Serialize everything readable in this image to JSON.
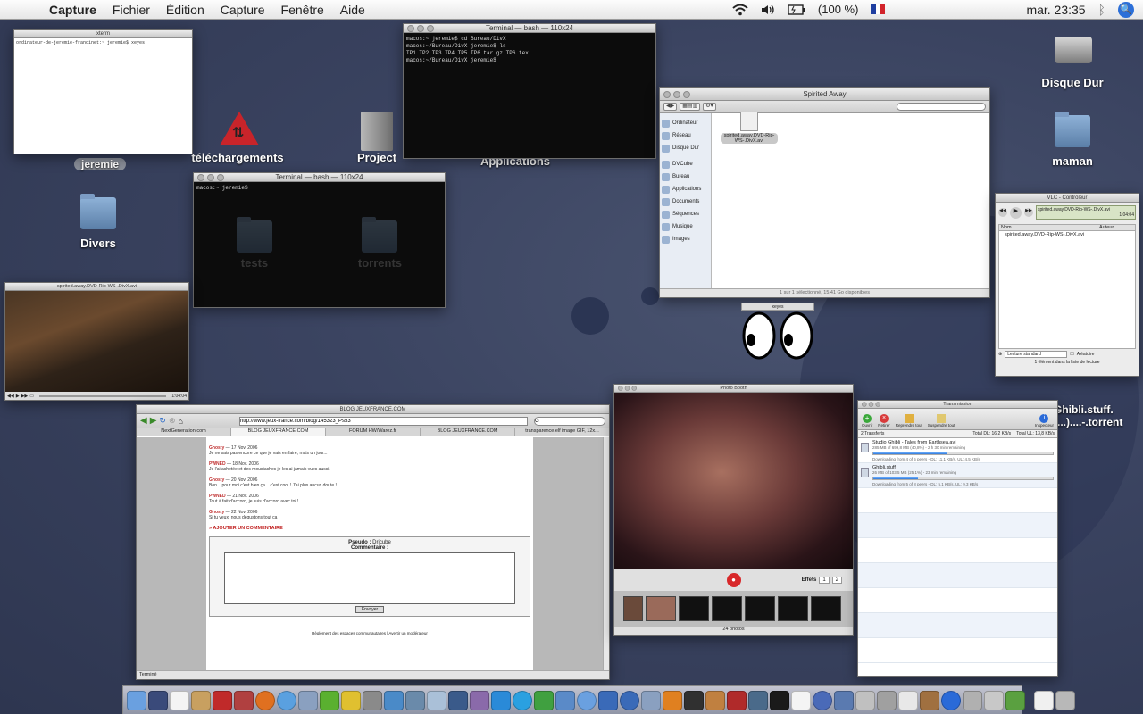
{
  "menubar": {
    "app_name": "Capture",
    "items": [
      "Fichier",
      "Édition",
      "Capture",
      "Fenêtre",
      "Aide"
    ],
    "battery": "(100 %)",
    "clock": "mar. 23:35"
  },
  "desktop": {
    "icons": [
      {
        "label": "jeremie"
      },
      {
        "label": "téléchargements"
      },
      {
        "label": "Project"
      },
      {
        "label": "Applications"
      },
      {
        "label": "Disque Dur"
      },
      {
        "label": "maman"
      },
      {
        "label": "Divers"
      },
      {
        "label": "tests"
      },
      {
        "label": "torrents"
      },
      {
        "label": "Ghibli.stuff.(...)....-.torrent"
      }
    ]
  },
  "xterm": {
    "title": "xterm",
    "line1": "ordinateur-de-jeremie-francinet:~ jeremie$ xeyes"
  },
  "terminal1": {
    "title": "Terminal — bash — 110x24",
    "line1": "macos:~ jeremie$ cd Bureau/DivX",
    "line2": "macos:~/Bureau/DivX jeremie$ ls",
    "line3": "TP1  TP2  TP3  TP4  TP5  TP6.tar.gz  TP6.tex",
    "line4": "macos:~/Bureau/DivX jeremie$"
  },
  "terminal2": {
    "title": "Terminal — bash — 110x24",
    "line1": "macos:~ jeremie$"
  },
  "finder": {
    "title": "Spirited Away",
    "search_placeholder": "",
    "sidebar": [
      "Ordinateur",
      "Réseau",
      "Disque Dur",
      "DVCube",
      "Bureau",
      "Applications",
      "Documents",
      "Séquences",
      "Musique",
      "Images"
    ],
    "file_name": "spirited.away.DVD-Rip-WS-.DivX.avi",
    "status": "1 sur 1 sélectionné, 15,41 Go disponibles"
  },
  "xeyes": {
    "title": "xeyes"
  },
  "vlc_video": {
    "title": "spirited.away.DVD-Rip-WS-.DivX.avi",
    "time": "1:04:04"
  },
  "vlc_controller": {
    "title": "VLC - Contrôleur",
    "now_playing": "spirited.away.DVD-Rip-WS-.DivX.avi",
    "time": "1:04:04",
    "col_name": "Nom",
    "col_author": "Auteur",
    "playlist_item": "spirited.away.DVD-Rip-WS-.DivX.avi",
    "mode": "Lecture standard",
    "random": "Aléatoire",
    "footer": "1 élément dans la liste de lecture"
  },
  "browser": {
    "title": "BLOG JEUXFRANCE.COM",
    "url": "http://www.jeux-france.com/blog/145323_Ps53",
    "search_value": "G",
    "tabs": [
      "NextGeneration.com",
      "BLOG JEUXFRANCE.COM",
      "FORUM HW/Warez.fr",
      "BLOG JEUXFRANCE.COM",
      "transparence.elf image GIF, 12x..."
    ],
    "comments": [
      {
        "author": "Ghosty",
        "date": "17 Nov. 2006",
        "text": "Je ne sais pas encore ce que je vais en faire, mais un jour..."
      },
      {
        "author": "PWNED",
        "date": "18 Nov. 2006",
        "text": "Je l'ai achetée et des moustaches je les ai jamais vues aussi."
      },
      {
        "author": "Ghosty",
        "date": "20 Nov. 2006",
        "text": "Bon... pour moi c'est bien ça... c'est cool ! J'ai plus aucun doute !"
      },
      {
        "author": "PWNED",
        "date": "21 Nov. 2006",
        "text": "Tout à fait d'accord, je suis d'accord avec toi !"
      },
      {
        "author": "Ghosty",
        "date": "22 Nov. 2006",
        "text": "Si tu veux, nous dégustons tout ça !"
      }
    ],
    "add_comment": "» AJOUTER UN COMMENTAIRE",
    "pseudo_label": "Pseudo :",
    "pseudo_value": "Dricube",
    "comment_label": "Commentaire :",
    "submit": "Envoyer",
    "footer": "Règlement des espaces communautaires | Avertir un modérateur",
    "status": "Terminé"
  },
  "photobooth": {
    "title": "Photo Booth",
    "effects_label": "Effets",
    "pages": [
      "1",
      "2"
    ],
    "count": "24 photos"
  },
  "transmission": {
    "title": "Transmission",
    "tools": [
      "Ouvrir",
      "Retirer",
      "Reprendre tout",
      "Suspendre tout",
      "Inspecteur"
    ],
    "summary_left": "2 Transferts",
    "summary_dl": "Total DL: 16,2 KB/s",
    "summary_ul": "Total UL: 13,8 KB/s",
    "torrents": [
      {
        "name": "Studio Ghibli - Tales from Earthsea.avi",
        "info": "285 MB of 699,8 MB (40,8%) - 2 h 30 min remaining",
        "status": "Downloading from 4 of 5 peers - DL: 11,1 KB/s, UL: 4,5 KB/s",
        "progress": 40.8
      },
      {
        "name": "Ghibli.stuff",
        "info": "26 MB of 103,5 MB (25,1%) - 23 min remaining",
        "status": "Downloading from 5 of 8 peers - DL: 5,1 KB/s, UL: 9,3 KB/s",
        "progress": 25.1
      }
    ]
  }
}
